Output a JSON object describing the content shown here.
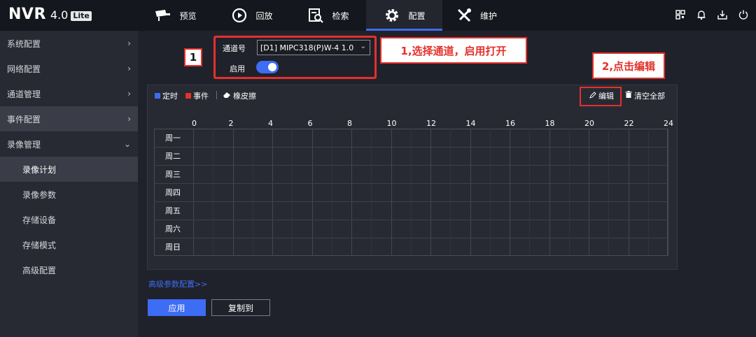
{
  "logo": {
    "name": "NVR",
    "version": "4.0",
    "badge": "Lite"
  },
  "nav": [
    {
      "label": "预览",
      "icon": "camera-icon"
    },
    {
      "label": "回放",
      "icon": "playback-icon"
    },
    {
      "label": "检索",
      "icon": "search-doc-icon"
    },
    {
      "label": "配置",
      "icon": "gear-icon",
      "active": true
    },
    {
      "label": "维护",
      "icon": "tools-icon"
    }
  ],
  "top_icons": [
    "qrcode-icon",
    "bell-icon",
    "download-icon",
    "power-icon"
  ],
  "sidebar": {
    "items": [
      {
        "label": "系统配置",
        "chevron": "›"
      },
      {
        "label": "网络配置",
        "chevron": "›"
      },
      {
        "label": "通道管理",
        "chevron": "›"
      },
      {
        "label": "事件配置",
        "chevron": "›"
      },
      {
        "label": "录像管理",
        "chevron": "⌄"
      }
    ],
    "subitems": [
      {
        "label": "录像计划",
        "active": true
      },
      {
        "label": "录像参数"
      },
      {
        "label": "存储设备"
      },
      {
        "label": "存储模式"
      },
      {
        "label": "高级配置"
      }
    ]
  },
  "channel": {
    "label": "通道号",
    "value": "[D1] MIPC318(P)W-4 1.0",
    "enable_label": "启用",
    "enabled": true
  },
  "annotations": {
    "step1": "1",
    "step1_text": "1,选择通道，启用打开",
    "step2": "2",
    "step2_text": "2,点击编辑"
  },
  "legend": {
    "timed": "定时",
    "event": "事件",
    "eraser": "橡皮擦"
  },
  "toolbar": {
    "edit": "编辑",
    "clear_all": "清空全部"
  },
  "schedule": {
    "hours": [
      "0",
      "2",
      "4",
      "6",
      "8",
      "10",
      "12",
      "14",
      "16",
      "18",
      "20",
      "22",
      "24"
    ],
    "days": [
      "周一",
      "周二",
      "周三",
      "周四",
      "周五",
      "周六",
      "周日"
    ]
  },
  "advanced_link": "高级参数配置>>",
  "buttons": {
    "apply": "应用",
    "copy": "复制到"
  },
  "colors": {
    "accent": "#3d6cf5",
    "timed": "#3d6cf5",
    "event": "#e4312b",
    "annotation": "#e4312b"
  }
}
